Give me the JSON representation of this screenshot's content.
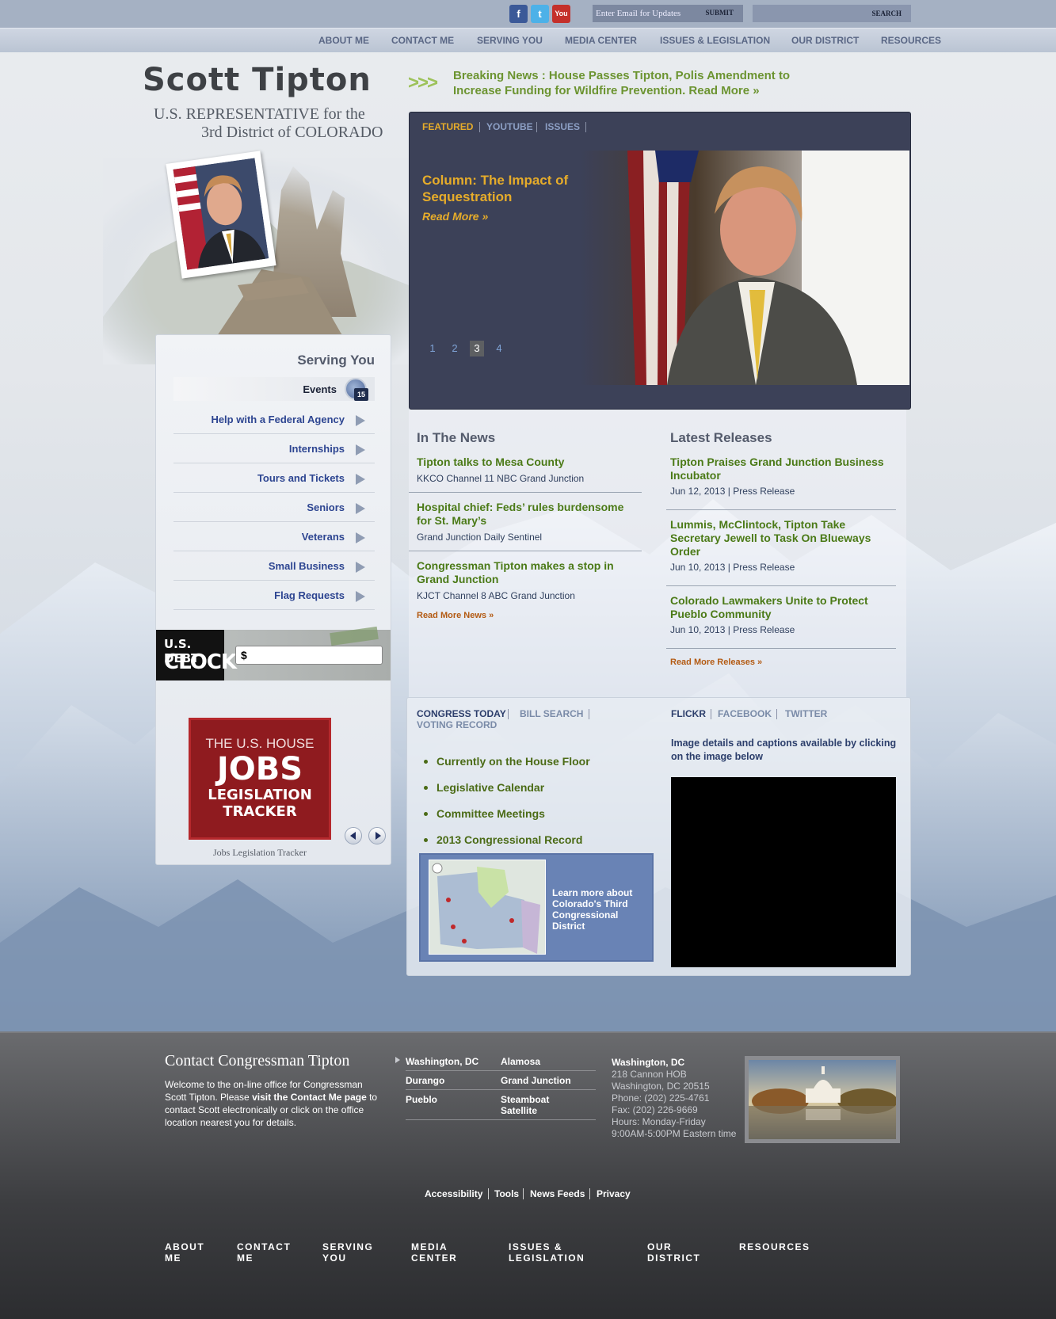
{
  "top": {
    "social": [
      "f",
      "t",
      "You"
    ],
    "email_placeholder": "Enter Email for Updates",
    "email_submit": "SUBMIT",
    "search_label": "SEARCH"
  },
  "nav": [
    "ABOUT ME",
    "CONTACT ME",
    "SERVING YOU",
    "MEDIA CENTER",
    "ISSUES & LEGISLATION",
    "OUR DISTRICT",
    "RESOURCES"
  ],
  "header": {
    "name": "Scott Tipton",
    "line1": "U.S. REPRESENTATIVE for the",
    "line2": "3rd District of COLORADO",
    "arrows": ">>>",
    "breaking": "Breaking News : House Passes Tipton, Polis Amendment to Increase Funding for Wildfire Prevention. Read More »"
  },
  "featured": {
    "tabs": [
      "FEATURED",
      "YOUTUBE",
      "ISSUES"
    ],
    "title": "Column: The Impact of Sequestration",
    "read_more": "Read More »",
    "pages": [
      "1",
      "2",
      "3",
      "4"
    ],
    "active_page": "3"
  },
  "serving": {
    "title": "Serving You",
    "items": [
      "Events",
      "Help with a Federal Agency",
      "Internships",
      "Tours and Tickets",
      "Seniors",
      "Veterans",
      "Small Business",
      "Flag Requests"
    ],
    "events_badge": "15"
  },
  "debt": {
    "line1": "U.S. DEBT",
    "line2": "CLOCK",
    "value": "$"
  },
  "jobs": {
    "line1": "THE U.S. HOUSE",
    "line2": "JOBS",
    "line3": "LEGISLATION",
    "line4": "TRACKER",
    "caption": "Jobs Legislation Tracker"
  },
  "news": {
    "title": "In The News",
    "items": [
      {
        "headline": "Tipton talks to Mesa County",
        "source": "KKCO Channel 11 NBC Grand Junction"
      },
      {
        "headline": "Hospital chief: Feds’ rules burdensome for St. Mary’s",
        "source": "Grand Junction Daily Sentinel"
      },
      {
        "headline": "Congressman Tipton makes a stop in Grand Junction",
        "source": "KJCT Channel 8 ABC Grand Junction"
      }
    ],
    "more": "Read More News »"
  },
  "releases": {
    "title": "Latest Releases",
    "items": [
      {
        "headline": "Tipton Praises Grand Junction Business Incubator",
        "date": "Jun 12, 2013",
        "type": "Press Release"
      },
      {
        "headline": "Lummis, McClintock, Tipton Take Secretary Jewell to Task On Blueways Order",
        "date": "Jun 10, 2013",
        "type": "Press Release"
      },
      {
        "headline": "Colorado Lawmakers Unite to Protect Pueblo Community",
        "date": "Jun 10, 2013",
        "type": "Press Release"
      }
    ],
    "more": "Read More Releases »"
  },
  "congress": {
    "tabs": [
      "CONGRESS TODAY",
      "BILL SEARCH",
      "VOTING RECORD"
    ],
    "links": [
      "Currently on the House Floor",
      "Legislative Calendar",
      "Committee Meetings",
      "2013 Congressional Record"
    ],
    "district_text": "Learn more about Colorado's Third Congressional District"
  },
  "social_feed": {
    "tabs": [
      "FLICKR",
      "FACEBOOK",
      "TWITTER"
    ],
    "text": "Image details and captions available by clicking on the image below"
  },
  "footer": {
    "title": "Contact Congressman Tipton",
    "text1": "Welcome to the on-line office for Congressman Scott Tipton. Please ",
    "text_link": "visit the Contact Me page",
    "text2": " to contact Scott electronically or click on the office location nearest you for details.",
    "offices": [
      "Washington, DC",
      "Alamosa",
      "Durango",
      "Grand Junction",
      "Pueblo",
      "Steamboat Satellite"
    ],
    "address": {
      "title": "Washington, DC",
      "street": "218 Cannon HOB",
      "city": "Washington, DC 20515",
      "phone": "Phone: (202) 225-4761",
      "fax": "Fax: (202) 226-9669",
      "hours": "Hours: Monday-Friday",
      "time": "9:00AM-5:00PM Eastern time"
    },
    "links": [
      "Accessibility",
      "Tools",
      "News Feeds",
      "Privacy"
    ],
    "nav": [
      "ABOUT ME",
      "CONTACT ME",
      "SERVING YOU",
      "MEDIA CENTER",
      "ISSUES & LEGISLATION",
      "OUR DISTRICT",
      "RESOURCES"
    ]
  },
  "colors": {
    "accent_green": "#4b7a17",
    "featured_gold": "#e6ac2a",
    "nav_blue": "#2d4591"
  }
}
